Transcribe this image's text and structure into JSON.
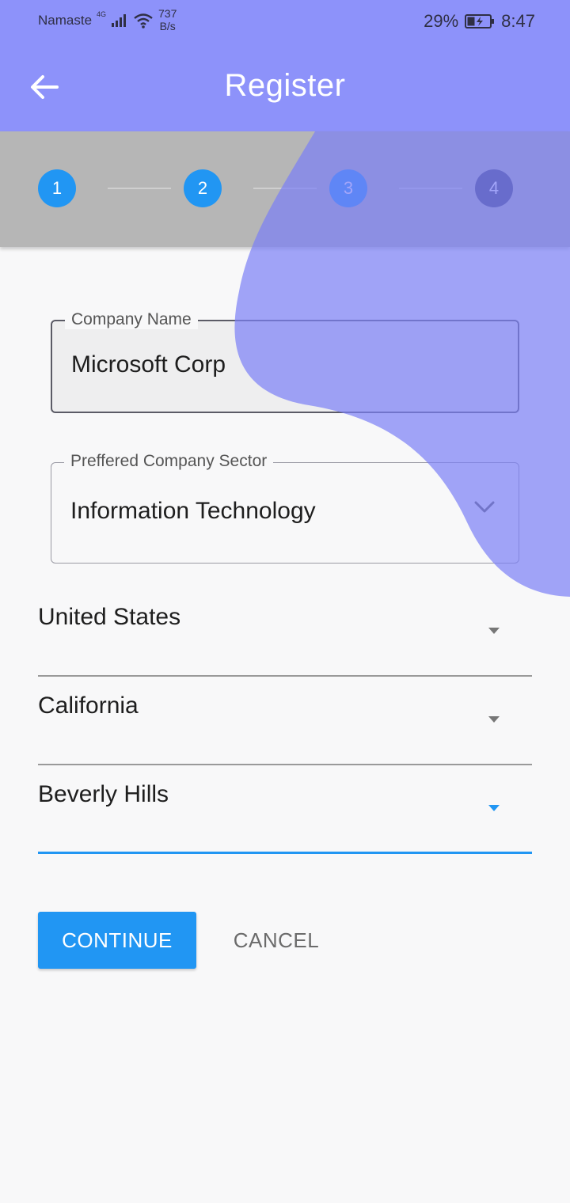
{
  "status_bar": {
    "carrier": "Namaste",
    "network_badge": "4G",
    "speed_value": "737",
    "speed_unit": "B/s",
    "battery_percent": "29%",
    "time": "8:47"
  },
  "app_bar": {
    "title": "Register",
    "back_icon": "arrow-left-icon"
  },
  "stepper": {
    "steps": [
      {
        "label": "1",
        "state": "complete"
      },
      {
        "label": "2",
        "state": "complete"
      },
      {
        "label": "3",
        "state": "current"
      },
      {
        "label": "4",
        "state": "upcoming"
      }
    ]
  },
  "form": {
    "company_name": {
      "label": "Company Name",
      "value": "Microsoft Corp"
    },
    "company_sector": {
      "label": "Preffered Company Sector",
      "value": "Information Technology"
    },
    "country": {
      "value": "United States"
    },
    "state": {
      "value": "California"
    },
    "city": {
      "value": "Beverly Hills"
    }
  },
  "actions": {
    "continue_label": "CONTINUE",
    "cancel_label": "CANCEL"
  },
  "colors": {
    "app_bar": "#8d92fa",
    "accent": "#2196f3",
    "step_upcoming": "#3f416a"
  }
}
